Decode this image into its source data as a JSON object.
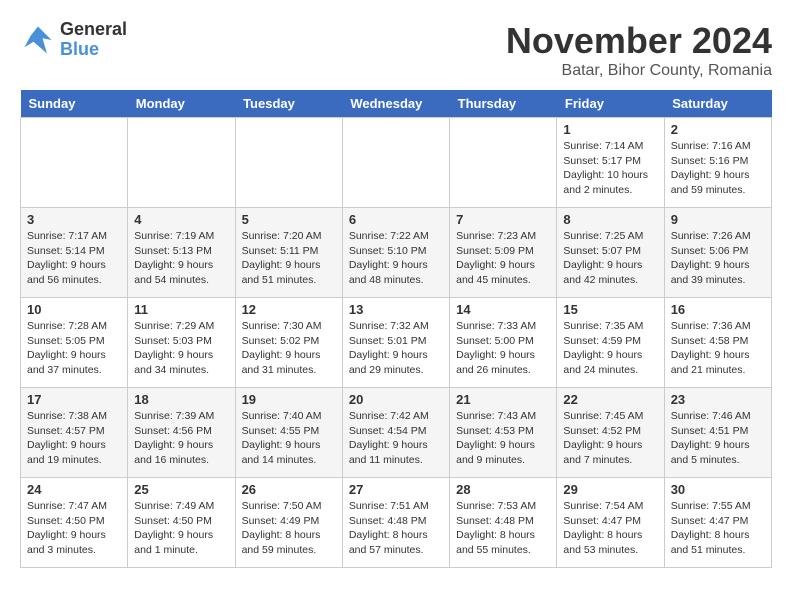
{
  "logo": {
    "line1": "General",
    "line2": "Blue"
  },
  "title": "November 2024",
  "subtitle": "Batar, Bihor County, Romania",
  "days_of_week": [
    "Sunday",
    "Monday",
    "Tuesday",
    "Wednesday",
    "Thursday",
    "Friday",
    "Saturday"
  ],
  "weeks": [
    [
      {
        "day": "",
        "content": ""
      },
      {
        "day": "",
        "content": ""
      },
      {
        "day": "",
        "content": ""
      },
      {
        "day": "",
        "content": ""
      },
      {
        "day": "",
        "content": ""
      },
      {
        "day": "1",
        "content": "Sunrise: 7:14 AM\nSunset: 5:17 PM\nDaylight: 10 hours and 2 minutes."
      },
      {
        "day": "2",
        "content": "Sunrise: 7:16 AM\nSunset: 5:16 PM\nDaylight: 9 hours and 59 minutes."
      }
    ],
    [
      {
        "day": "3",
        "content": "Sunrise: 7:17 AM\nSunset: 5:14 PM\nDaylight: 9 hours and 56 minutes."
      },
      {
        "day": "4",
        "content": "Sunrise: 7:19 AM\nSunset: 5:13 PM\nDaylight: 9 hours and 54 minutes."
      },
      {
        "day": "5",
        "content": "Sunrise: 7:20 AM\nSunset: 5:11 PM\nDaylight: 9 hours and 51 minutes."
      },
      {
        "day": "6",
        "content": "Sunrise: 7:22 AM\nSunset: 5:10 PM\nDaylight: 9 hours and 48 minutes."
      },
      {
        "day": "7",
        "content": "Sunrise: 7:23 AM\nSunset: 5:09 PM\nDaylight: 9 hours and 45 minutes."
      },
      {
        "day": "8",
        "content": "Sunrise: 7:25 AM\nSunset: 5:07 PM\nDaylight: 9 hours and 42 minutes."
      },
      {
        "day": "9",
        "content": "Sunrise: 7:26 AM\nSunset: 5:06 PM\nDaylight: 9 hours and 39 minutes."
      }
    ],
    [
      {
        "day": "10",
        "content": "Sunrise: 7:28 AM\nSunset: 5:05 PM\nDaylight: 9 hours and 37 minutes."
      },
      {
        "day": "11",
        "content": "Sunrise: 7:29 AM\nSunset: 5:03 PM\nDaylight: 9 hours and 34 minutes."
      },
      {
        "day": "12",
        "content": "Sunrise: 7:30 AM\nSunset: 5:02 PM\nDaylight: 9 hours and 31 minutes."
      },
      {
        "day": "13",
        "content": "Sunrise: 7:32 AM\nSunset: 5:01 PM\nDaylight: 9 hours and 29 minutes."
      },
      {
        "day": "14",
        "content": "Sunrise: 7:33 AM\nSunset: 5:00 PM\nDaylight: 9 hours and 26 minutes."
      },
      {
        "day": "15",
        "content": "Sunrise: 7:35 AM\nSunset: 4:59 PM\nDaylight: 9 hours and 24 minutes."
      },
      {
        "day": "16",
        "content": "Sunrise: 7:36 AM\nSunset: 4:58 PM\nDaylight: 9 hours and 21 minutes."
      }
    ],
    [
      {
        "day": "17",
        "content": "Sunrise: 7:38 AM\nSunset: 4:57 PM\nDaylight: 9 hours and 19 minutes."
      },
      {
        "day": "18",
        "content": "Sunrise: 7:39 AM\nSunset: 4:56 PM\nDaylight: 9 hours and 16 minutes."
      },
      {
        "day": "19",
        "content": "Sunrise: 7:40 AM\nSunset: 4:55 PM\nDaylight: 9 hours and 14 minutes."
      },
      {
        "day": "20",
        "content": "Sunrise: 7:42 AM\nSunset: 4:54 PM\nDaylight: 9 hours and 11 minutes."
      },
      {
        "day": "21",
        "content": "Sunrise: 7:43 AM\nSunset: 4:53 PM\nDaylight: 9 hours and 9 minutes."
      },
      {
        "day": "22",
        "content": "Sunrise: 7:45 AM\nSunset: 4:52 PM\nDaylight: 9 hours and 7 minutes."
      },
      {
        "day": "23",
        "content": "Sunrise: 7:46 AM\nSunset: 4:51 PM\nDaylight: 9 hours and 5 minutes."
      }
    ],
    [
      {
        "day": "24",
        "content": "Sunrise: 7:47 AM\nSunset: 4:50 PM\nDaylight: 9 hours and 3 minutes."
      },
      {
        "day": "25",
        "content": "Sunrise: 7:49 AM\nSunset: 4:50 PM\nDaylight: 9 hours and 1 minute."
      },
      {
        "day": "26",
        "content": "Sunrise: 7:50 AM\nSunset: 4:49 PM\nDaylight: 8 hours and 59 minutes."
      },
      {
        "day": "27",
        "content": "Sunrise: 7:51 AM\nSunset: 4:48 PM\nDaylight: 8 hours and 57 minutes."
      },
      {
        "day": "28",
        "content": "Sunrise: 7:53 AM\nSunset: 4:48 PM\nDaylight: 8 hours and 55 minutes."
      },
      {
        "day": "29",
        "content": "Sunrise: 7:54 AM\nSunset: 4:47 PM\nDaylight: 8 hours and 53 minutes."
      },
      {
        "day": "30",
        "content": "Sunrise: 7:55 AM\nSunset: 4:47 PM\nDaylight: 8 hours and 51 minutes."
      }
    ]
  ]
}
